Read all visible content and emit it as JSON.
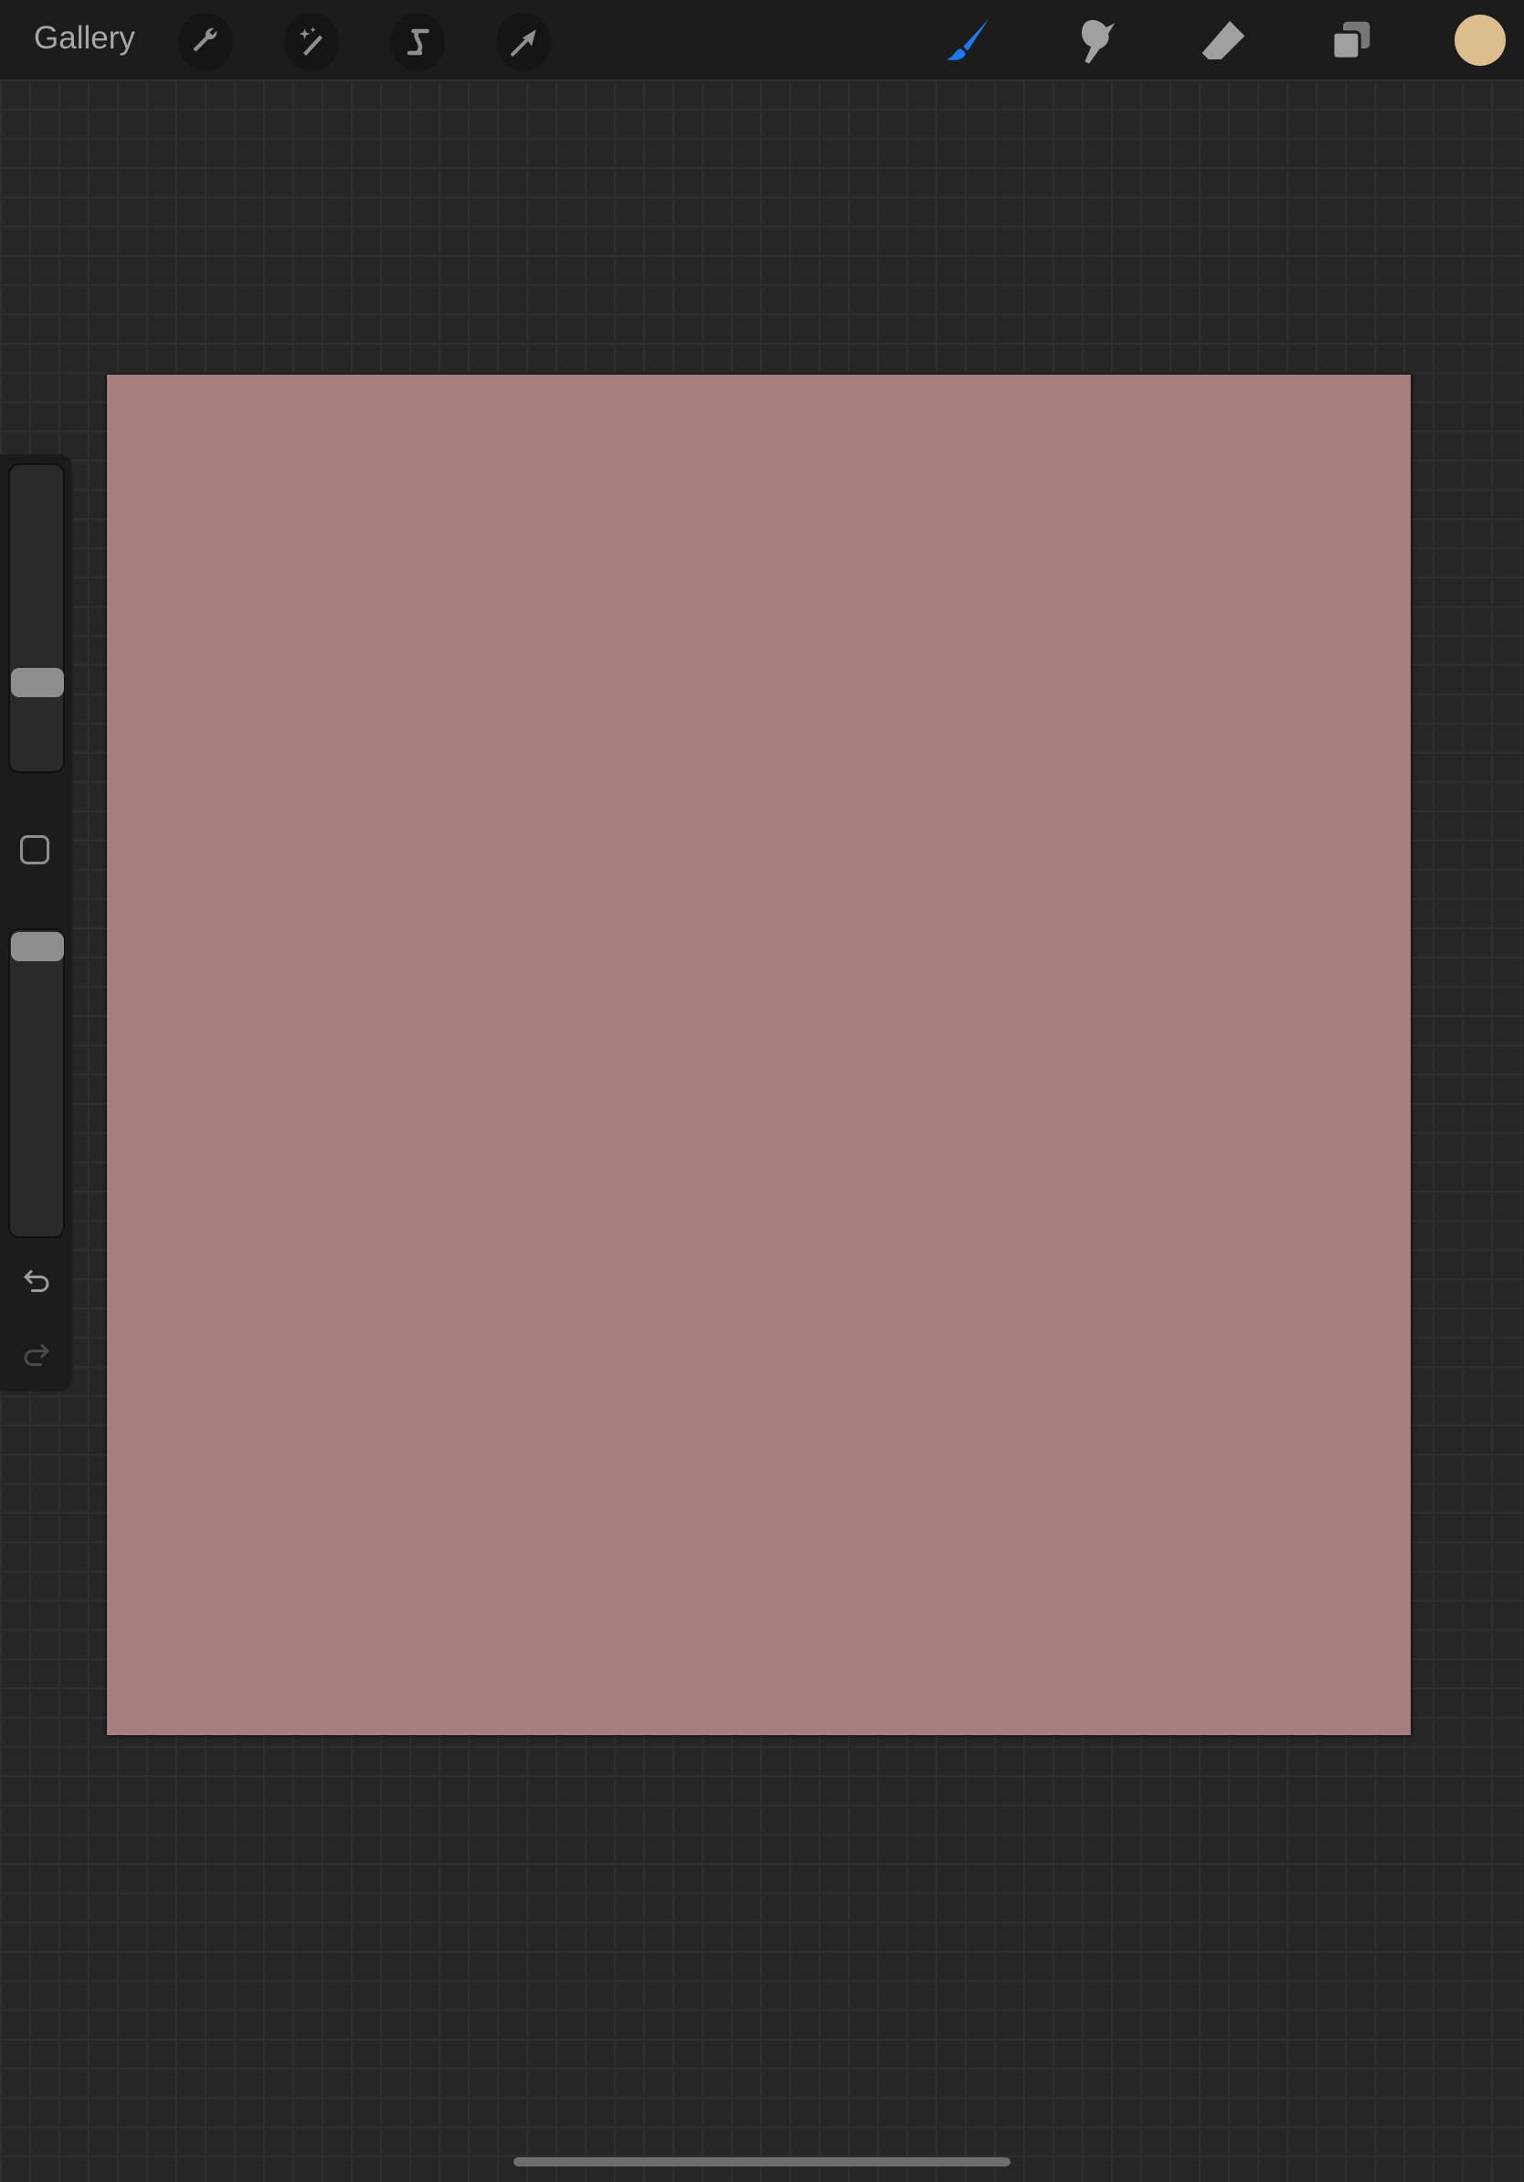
{
  "topbar": {
    "gallery_label": "Gallery",
    "left_tools": [
      "wrench-icon",
      "magic-wand-icon",
      "selection-icon",
      "transform-arrow-icon"
    ],
    "right_tools": [
      "brush-icon",
      "smudge-icon",
      "eraser-icon",
      "layers-icon"
    ],
    "active_tool": "brush",
    "current_color": "#dcbd8c",
    "accent": "#1a7cf5"
  },
  "sidebar": {
    "brush_size": 0.27,
    "opacity": 1.0
  },
  "canvas": {
    "background": "#a77e7e"
  }
}
